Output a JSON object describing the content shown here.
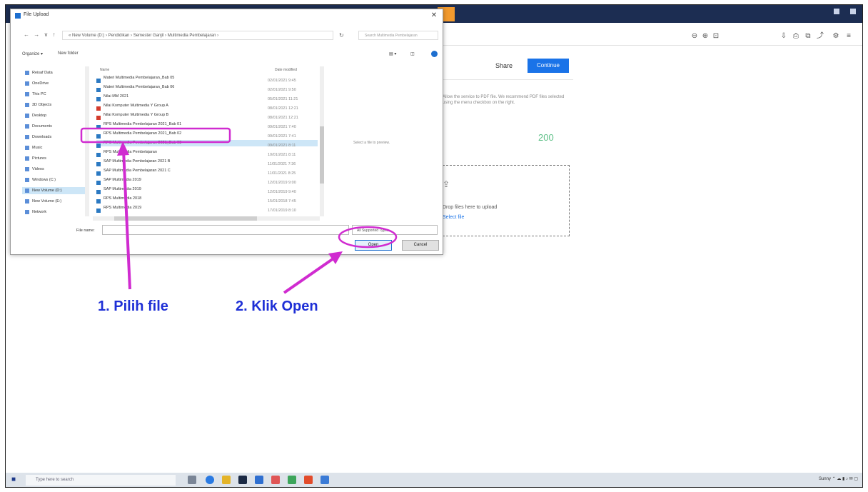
{
  "dialog": {
    "title": "File Upload",
    "address": "« New Volume (D:) › Pendidikan › Semester Ganjil › Multimedia Pembelajaran ›",
    "search_placeholder": "Search Multimedia Pembelajaran",
    "organize": "Organize ▾",
    "new_folder": "New folder",
    "col_name": "Name",
    "col_date": "Date modified",
    "nav_items": [
      {
        "label": "Reisaf Data",
        "selected": false
      },
      {
        "label": "OneDrive",
        "selected": false
      },
      {
        "label": "This PC",
        "selected": false
      },
      {
        "label": "3D Objects",
        "selected": false
      },
      {
        "label": "Desktop",
        "selected": false
      },
      {
        "label": "Documents",
        "selected": false
      },
      {
        "label": "Downloads",
        "selected": false
      },
      {
        "label": "Music",
        "selected": false
      },
      {
        "label": "Pictures",
        "selected": false
      },
      {
        "label": "Videos",
        "selected": false
      },
      {
        "label": "Windows (C:)",
        "selected": false
      },
      {
        "label": "New Volume (D:)",
        "selected": true
      },
      {
        "label": "New Volume (E:)",
        "selected": false
      },
      {
        "label": "Network",
        "selected": false
      }
    ],
    "files": [
      {
        "name": "Materi Multimedia Pembelajaran_Bab 05",
        "date": "02/01/2021 9:45",
        "type": "doc"
      },
      {
        "name": "Materi Multimedia Pembelajaran_Bab 06",
        "date": "02/01/2021 9:50",
        "type": "doc"
      },
      {
        "name": "Nilai MM 2021",
        "date": "05/01/2021 11:21",
        "type": "doc"
      },
      {
        "name": "Nilai Komputer Multimedia Y Group A",
        "date": "08/01/2021 12:21",
        "type": "pdf"
      },
      {
        "name": "Nilai Komputer Multimedia Y Group B",
        "date": "08/01/2021 12:21",
        "type": "pdf"
      },
      {
        "name": "RPS Multimedia Pembelajaran 2021_Bab 01",
        "date": "09/01/2021 7:40",
        "type": "doc"
      },
      {
        "name": "RPS Multimedia Pembelajaran 2021_Bab 02",
        "date": "09/01/2021 7:41",
        "type": "doc"
      },
      {
        "name": "RPS Multimedia Pembelajaran 2021_Bab 03",
        "date": "09/01/2021 8:11",
        "type": "doc"
      },
      {
        "name": "RPS Multimedia Pembelajaran",
        "date": "10/01/2021 8:11",
        "type": "doc"
      },
      {
        "name": "SAP Multimedia Pembelajaran 2021 B",
        "date": "11/01/2021 7:36",
        "type": "doc"
      },
      {
        "name": "SAP Multimedia Pembelajaran 2021 C",
        "date": "11/01/2021 8:25",
        "type": "doc"
      },
      {
        "name": "SAP Multimedia 2019",
        "date": "12/01/2019 9:00",
        "type": "doc"
      },
      {
        "name": "SAP Multimedia 2019",
        "date": "12/01/2019 9:40",
        "type": "doc"
      },
      {
        "name": "RPS Multimedia 2018",
        "date": "15/01/2018 7:45",
        "type": "doc"
      },
      {
        "name": "RPS Multimedia 2019",
        "date": "17/01/2019 8:10",
        "type": "doc"
      }
    ],
    "highlighted_index": 7,
    "preview_text": "Select a file to preview.",
    "file_name_label": "File name:",
    "file_type": "All Supported Types",
    "open_label": "Open",
    "cancel_label": "Cancel"
  },
  "background_app": {
    "share_label": "Share",
    "primary_label": "Continue",
    "hint_text": "Allow the service to PDF file. We recommend PDF files selected using the menu checkbox on the right.",
    "zoom_value": "200",
    "drop_text": "Drop files here to upload",
    "drop_link": "Select file"
  },
  "annotations": {
    "step1": "1.  Pilih file",
    "step2": "2.  Klik Open",
    "color": "#d02bd0",
    "label_color": "#1e2fd6"
  },
  "taskbar": {
    "search_placeholder": "Type here to search",
    "tray_text": "Sunny"
  }
}
